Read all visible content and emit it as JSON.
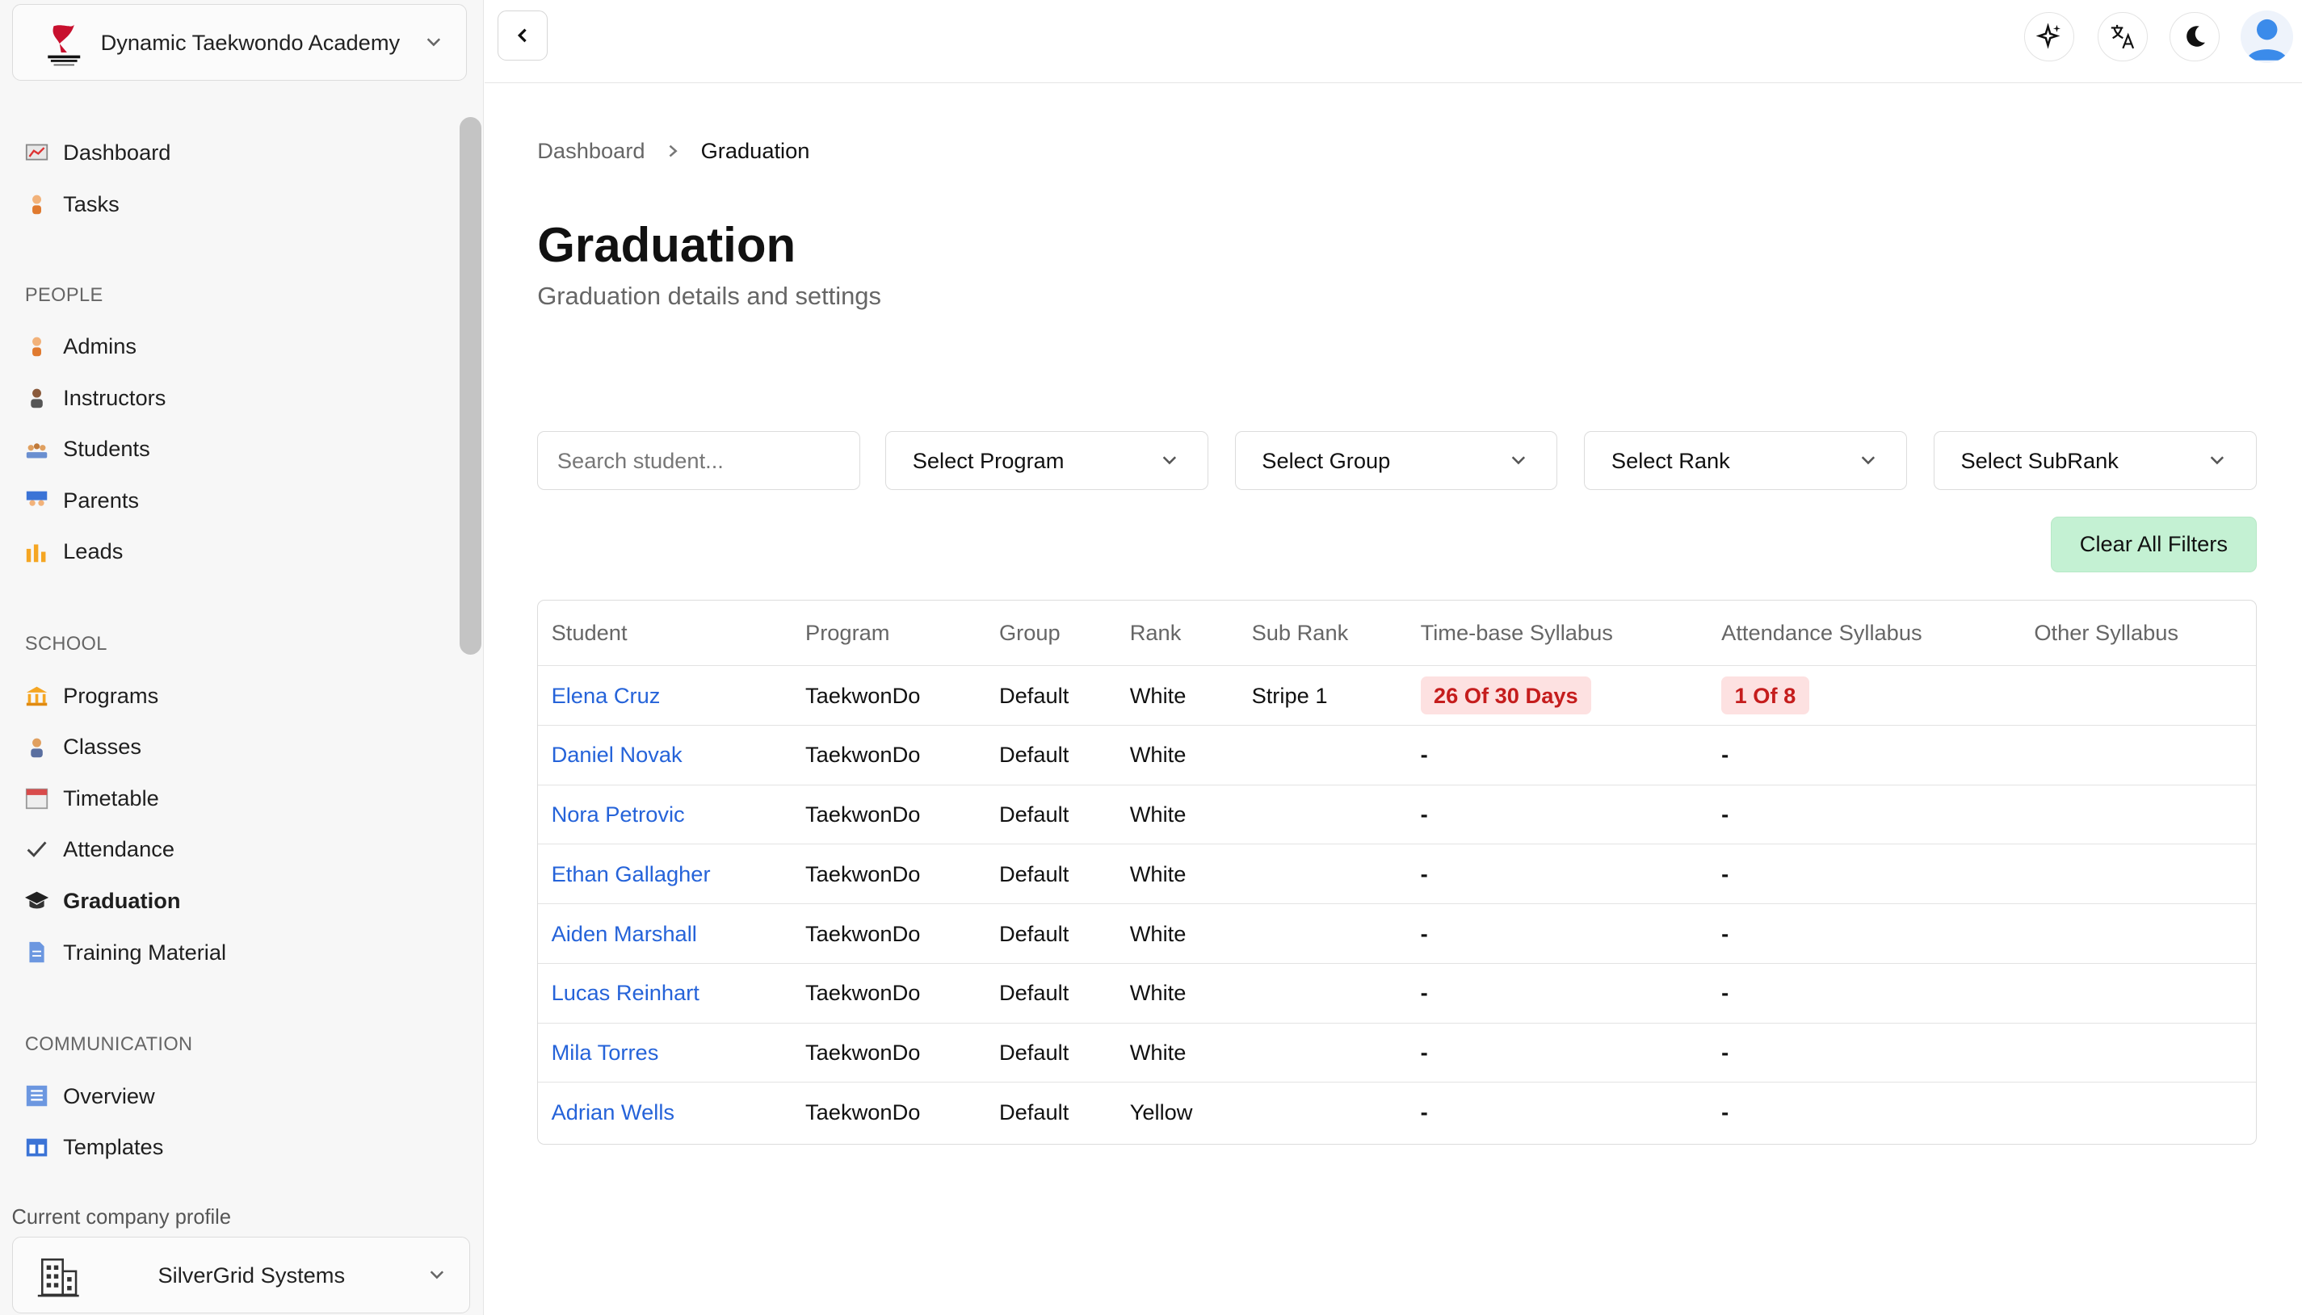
{
  "org": {
    "name": "Dynamic Taekwondo Academy"
  },
  "sidebar": {
    "top_items": [
      {
        "label": "Dashboard",
        "icon": "chart-icon"
      },
      {
        "label": "Tasks",
        "icon": "person-icon"
      }
    ],
    "sections": [
      {
        "label": "PEOPLE",
        "items": [
          {
            "label": "Admins",
            "icon": "admin-icon"
          },
          {
            "label": "Instructors",
            "icon": "instructor-icon"
          },
          {
            "label": "Students",
            "icon": "students-icon"
          },
          {
            "label": "Parents",
            "icon": "parents-icon"
          },
          {
            "label": "Leads",
            "icon": "bar-chart-icon"
          }
        ]
      },
      {
        "label": "SCHOOL",
        "items": [
          {
            "label": "Programs",
            "icon": "building-icon"
          },
          {
            "label": "Classes",
            "icon": "class-icon"
          },
          {
            "label": "Timetable",
            "icon": "calendar-icon"
          },
          {
            "label": "Attendance",
            "icon": "check-icon"
          },
          {
            "label": "Graduation",
            "icon": "graduation-cap-icon",
            "active": true
          },
          {
            "label": "Training Material",
            "icon": "document-icon"
          }
        ]
      },
      {
        "label": "COMMUNICATION",
        "items": [
          {
            "label": "Overview",
            "icon": "list-icon"
          },
          {
            "label": "Templates",
            "icon": "template-icon"
          }
        ]
      }
    ],
    "profile_label": "Current company profile",
    "company": "SilverGrid Systems"
  },
  "breadcrumb": {
    "root": "Dashboard",
    "current": "Graduation"
  },
  "page": {
    "title": "Graduation",
    "subtitle": "Graduation details and settings"
  },
  "filters": {
    "search_placeholder": "Search student...",
    "program": "Select Program",
    "group": "Select Group",
    "rank": "Select Rank",
    "subrank": "Select SubRank",
    "clear_label": "Clear All Filters"
  },
  "table": {
    "headers": [
      "Student",
      "Program",
      "Group",
      "Rank",
      "Sub Rank",
      "Time-base Syllabus",
      "Attendance Syllabus",
      "Other Syllabus"
    ],
    "rows": [
      {
        "student": "Elena Cruz",
        "program": "TaekwonDo",
        "group": "Default",
        "rank": "White",
        "subrank": "Stripe 1",
        "time": "26 Of 30 Days",
        "attendance": "1 Of 8",
        "other": ""
      },
      {
        "student": "Daniel Novak",
        "program": "TaekwonDo",
        "group": "Default",
        "rank": "White",
        "subrank": "",
        "time": "-",
        "attendance": "-",
        "other": ""
      },
      {
        "student": "Nora Petrovic",
        "program": "TaekwonDo",
        "group": "Default",
        "rank": "White",
        "subrank": "",
        "time": "-",
        "attendance": "-",
        "other": ""
      },
      {
        "student": "Ethan Gallagher",
        "program": "TaekwonDo",
        "group": "Default",
        "rank": "White",
        "subrank": "",
        "time": "-",
        "attendance": "-",
        "other": ""
      },
      {
        "student": "Aiden Marshall",
        "program": "TaekwonDo",
        "group": "Default",
        "rank": "White",
        "subrank": "",
        "time": "-",
        "attendance": "-",
        "other": ""
      },
      {
        "student": "Lucas Reinhart",
        "program": "TaekwonDo",
        "group": "Default",
        "rank": "White",
        "subrank": "",
        "time": "-",
        "attendance": "-",
        "other": ""
      },
      {
        "student": "Mila Torres",
        "program": "TaekwonDo",
        "group": "Default",
        "rank": "White",
        "subrank": "",
        "time": "-",
        "attendance": "-",
        "other": ""
      },
      {
        "student": "Adrian Wells",
        "program": "TaekwonDo",
        "group": "Default",
        "rank": "Yellow",
        "subrank": "",
        "time": "-",
        "attendance": "-",
        "other": ""
      }
    ]
  },
  "colors": {
    "link": "#2563d9",
    "badge_bg": "#fde1e1",
    "badge_text": "#c51d1d",
    "clear_button": "#c4f1d3"
  }
}
